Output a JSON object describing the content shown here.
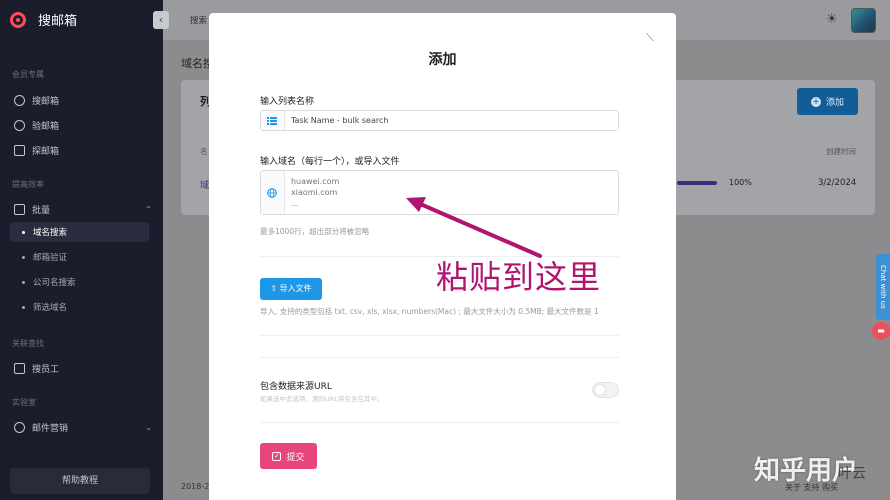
{
  "app": {
    "name": "搜邮箱",
    "brand_color": "#ff4b5c"
  },
  "sidebar": {
    "sections": {
      "member": "会员专属",
      "efficiency": "提高效率",
      "related": "关联查找",
      "lab": "实验室"
    },
    "items": {
      "search_email": "搜邮箱",
      "verify_email": "验邮箱",
      "explore_email": "探邮箱",
      "bulk": "批量",
      "domain_search": "域名搜索",
      "email_verify": "邮箱验证",
      "company_search": "公司名搜索",
      "filter_domain": "筛选域名",
      "search_staff": "搜员工",
      "email_marketing": "邮件营销"
    },
    "help": "帮助教程"
  },
  "topbar": {
    "search_tab": "搜索"
  },
  "background": {
    "page_title": "域名搜",
    "list_label": "列",
    "add_button": "添加",
    "col_name": "名",
    "col_created": "创建时间",
    "row_link": "域",
    "row_percent": "100%",
    "row_date": "3/2/2024",
    "footer_left": "2018-2",
    "footer_right": "关于 支持 购买"
  },
  "chat": {
    "tab_label": "Chat with us"
  },
  "modal": {
    "title": "添加",
    "list_name_label": "输入列表名称",
    "list_name_placeholder": "Task Name - bulk search",
    "domain_label": "输入域名（每行一个），或导入文件",
    "domain_placeholder": "huawei.com\nxiaomi.com\n...",
    "domain_hint": "最多1000行，超出部分将被忽略",
    "import_button": "导入文件",
    "import_hint": "导入, 支持的类型包括 txt, csv, xls, xlsx, numbers(Mac) ; 最大文件大小为 0.5MB; 最大文件数是 1",
    "source_url_label": "包含数据来源URL",
    "source_url_hint": "如果选中此选项，源的URL将包含在其中。",
    "submit_button": "提交",
    "submit_color": "#e8467a",
    "import_color": "#1e97e8"
  },
  "annotation": {
    "text": "粘贴到这里",
    "color": "#b0146e"
  },
  "watermark": {
    "text": "知乎用户",
    "sub": "叶云"
  }
}
